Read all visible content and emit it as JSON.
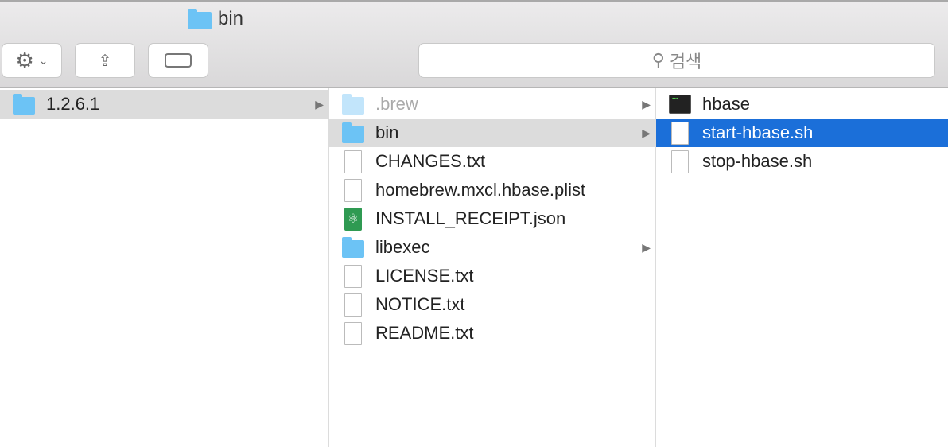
{
  "window": {
    "title": "bin"
  },
  "toolbar": {
    "search_placeholder": "검색",
    "action": "gear-icon",
    "share": "share-icon",
    "tag": "tag-icon"
  },
  "columns": [
    {
      "items": [
        {
          "name": "1.2.6.1",
          "icon": "folder",
          "has_children": true,
          "state": "path"
        }
      ]
    },
    {
      "items": [
        {
          "name": ".brew",
          "icon": "folder",
          "has_children": true,
          "state": "hidden"
        },
        {
          "name": "bin",
          "icon": "folder",
          "has_children": true,
          "state": "path"
        },
        {
          "name": "CHANGES.txt",
          "icon": "text-file"
        },
        {
          "name": "homebrew.mxcl.hbase.plist",
          "icon": "plist-file"
        },
        {
          "name": "INSTALL_RECEIPT.json",
          "icon": "json-file"
        },
        {
          "name": "libexec",
          "icon": "folder",
          "has_children": true
        },
        {
          "name": "LICENSE.txt",
          "icon": "text-file"
        },
        {
          "name": "NOTICE.txt",
          "icon": "text-file"
        },
        {
          "name": "README.txt",
          "icon": "text-file"
        }
      ]
    },
    {
      "items": [
        {
          "name": "hbase",
          "icon": "terminal-exec"
        },
        {
          "name": "start-hbase.sh",
          "icon": "script-file",
          "state": "selected"
        },
        {
          "name": "stop-hbase.sh",
          "icon": "script-file"
        }
      ]
    }
  ],
  "colors": {
    "selection": "#1b6fd9",
    "folder": "#6cc3f5"
  }
}
